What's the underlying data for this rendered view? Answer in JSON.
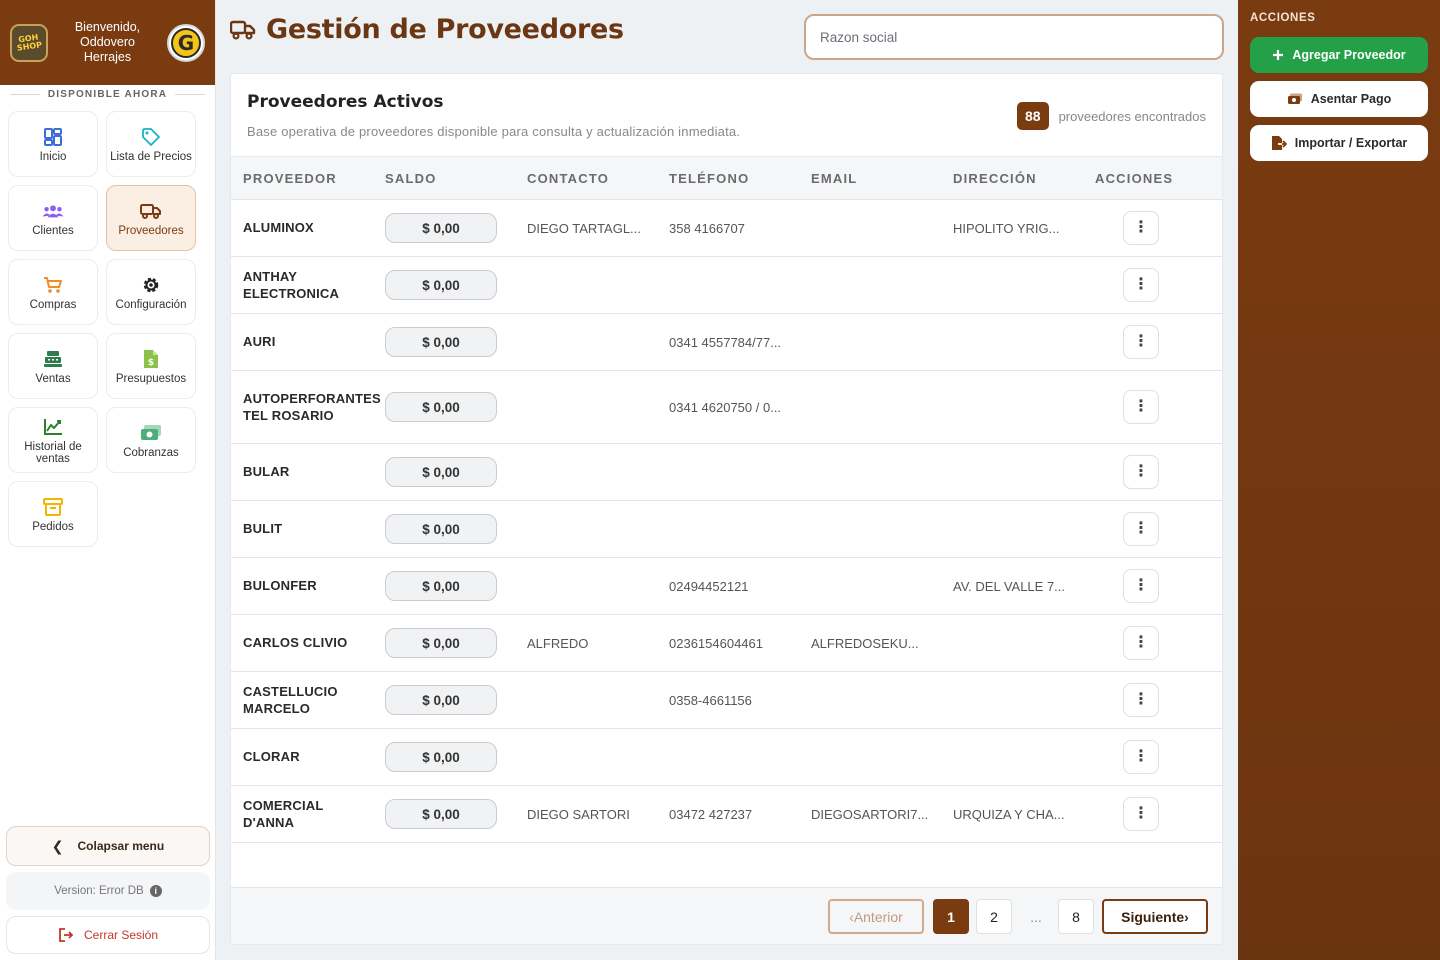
{
  "sidebar": {
    "welcome_line1": "Bienvenido,",
    "welcome_line2": "Oddovero",
    "welcome_line3": "Herrajes",
    "logo_left_text": "GOH SHOP",
    "logo_right_text": "G",
    "available_label": "DISPONIBLE AHORA",
    "items": [
      {
        "label": "Inicio",
        "icon": "dashboard-icon",
        "color": "#3b6fd8"
      },
      {
        "label": "Lista de Precios",
        "icon": "tag-icon",
        "color": "#19b3c4"
      },
      {
        "label": "Clientes",
        "icon": "users-icon",
        "color": "#8b5cf6"
      },
      {
        "label": "Proveedores",
        "icon": "truck-icon",
        "color": "#7a3b10",
        "active": true
      },
      {
        "label": "Compras",
        "icon": "cart-icon",
        "color": "#f28c28"
      },
      {
        "label": "Configuración",
        "icon": "gear-icon",
        "color": "#222222"
      },
      {
        "label": "Ventas",
        "icon": "cash-register-icon",
        "color": "#2e7d4f"
      },
      {
        "label": "Presupuestos",
        "icon": "file-dollar-icon",
        "color": "#8bc34a"
      },
      {
        "label": "Historial de ventas",
        "icon": "chart-line-icon",
        "color": "#2e7d32"
      },
      {
        "label": "Cobranzas",
        "icon": "money-icon",
        "color": "#4caf7a"
      },
      {
        "label": "Pedidos",
        "icon": "box-icon",
        "color": "#f4b400"
      }
    ],
    "collapse_label": "Colapsar menu",
    "version_label": "Version: Error DB",
    "logout_label": "Cerrar Sesión"
  },
  "header": {
    "title": "Gestión de Proveedores",
    "search_placeholder": "Razon social"
  },
  "card": {
    "title": "Proveedores Activos",
    "subtitle": "Base operativa de proveedores disponible para consulta y actualización inmediata.",
    "count": "88",
    "count_label": "proveedores encontrados"
  },
  "table": {
    "columns": [
      "PROVEEDOR",
      "SALDO",
      "CONTACTO",
      "TELÉFONO",
      "EMAIL",
      "DIRECCIÓN",
      "ACCIONES"
    ],
    "rows": [
      {
        "proveedor": "ALUMINOX",
        "saldo": "$ 0,00",
        "contacto": "DIEGO TARTAGL...",
        "telefono": "358 4166707",
        "email": "",
        "direccion": "HIPOLITO YRIG..."
      },
      {
        "proveedor": "ANTHAY ELECTRONICA",
        "saldo": "$ 0,00",
        "contacto": "",
        "telefono": "",
        "email": "",
        "direccion": ""
      },
      {
        "proveedor": "AURI",
        "saldo": "$ 0,00",
        "contacto": "",
        "telefono": "0341 4557784/77...",
        "email": "",
        "direccion": ""
      },
      {
        "proveedor": "AUTOPERFORANTES TEL ROSARIO",
        "saldo": "$ 0,00",
        "contacto": "",
        "telefono": "0341 4620750 / 0...",
        "email": "",
        "direccion": ""
      },
      {
        "proveedor": "BULAR",
        "saldo": "$ 0,00",
        "contacto": "",
        "telefono": "",
        "email": "",
        "direccion": ""
      },
      {
        "proveedor": "BULIT",
        "saldo": "$ 0,00",
        "contacto": "",
        "telefono": "",
        "email": "",
        "direccion": ""
      },
      {
        "proveedor": "BULONFER",
        "saldo": "$ 0,00",
        "contacto": "",
        "telefono": "02494452121",
        "email": "",
        "direccion": "AV. DEL VALLE 7..."
      },
      {
        "proveedor": "CARLOS CLIVIO",
        "saldo": "$ 0,00",
        "contacto": "ALFREDO",
        "telefono": "0236154604461",
        "email": "ALFREDOSEKU...",
        "direccion": ""
      },
      {
        "proveedor": "CASTELLUCIO MARCELO",
        "saldo": "$ 0,00",
        "contacto": "",
        "telefono": "0358-4661156",
        "email": "",
        "direccion": ""
      },
      {
        "proveedor": "CLORAR",
        "saldo": "$ 0,00",
        "contacto": "",
        "telefono": "",
        "email": "",
        "direccion": ""
      },
      {
        "proveedor": "COMERCIAL D'ANNA",
        "saldo": "$ 0,00",
        "contacto": "DIEGO SARTORI",
        "telefono": "03472 427237",
        "email": "DIEGOSARTORI7...",
        "direccion": "URQUIZA Y CHA..."
      }
    ],
    "actions_icon": "kebab-menu-icon"
  },
  "pagination": {
    "prev_label": "Anterior",
    "pages": [
      "1",
      "2",
      "8"
    ],
    "ellipsis": "...",
    "current_page": "1",
    "next_label": "Siguiente"
  },
  "actions_panel": {
    "title": "ACCIONES",
    "add_label": "Agregar Proveedor",
    "payment_label": "Asentar Pago",
    "import_label": "Importar / Exportar",
    "accent_color": "#24a148",
    "brand_color": "#7a3b10"
  }
}
